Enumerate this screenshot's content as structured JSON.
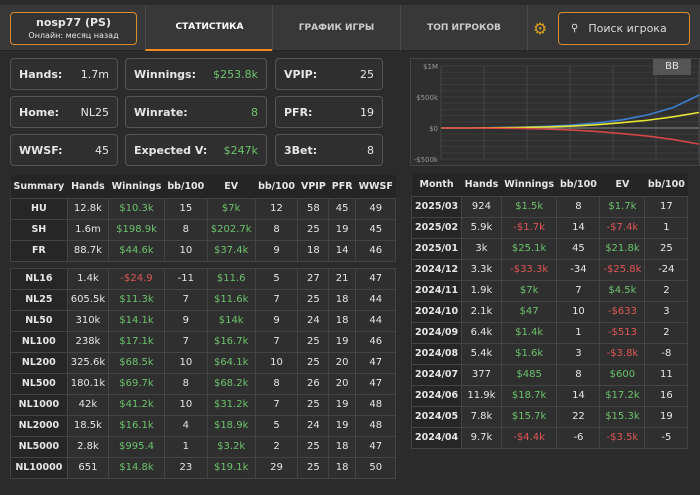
{
  "header": {
    "username": "nosp77 (PS)",
    "status": "Онлайн: месяц назад",
    "tabs": [
      "СТАТИСТИКА",
      "ГРАФИК ИГРЫ",
      "ТОП ИГРОКОВ"
    ],
    "active_tab": 0,
    "search_placeholder": "Поиск игрока"
  },
  "stats": [
    {
      "label": "Hands:",
      "value": "1.7m"
    },
    {
      "label": "Winnings:",
      "value": "$253.8k",
      "color": "green"
    },
    {
      "label": "VPIP:",
      "value": "25"
    },
    {
      "label": "Home:",
      "value": "NL25"
    },
    {
      "label": "Winrate:",
      "value": "8",
      "color": "green"
    },
    {
      "label": "PFR:",
      "value": "19"
    },
    {
      "label": "WWSF:",
      "value": "45"
    },
    {
      "label": "Expected V:",
      "value": "$247k",
      "color": "green"
    },
    {
      "label": "3Bet:",
      "value": "8"
    }
  ],
  "chart_data": {
    "type": "line",
    "unit_toggle": "BB",
    "y_ticks": [
      "$1M",
      "$500k",
      "$0",
      "-$500k"
    ],
    "ylim": [
      -500000,
      1000000
    ],
    "grid": true,
    "series": [
      {
        "color": "#3d7fd6",
        "values": [
          0,
          0,
          5000,
          12000,
          25000,
          45000,
          80000,
          130000,
          210000,
          330000,
          530000
        ]
      },
      {
        "color": "#e6e633",
        "values": [
          0,
          0,
          3000,
          8000,
          16000,
          30000,
          52000,
          85000,
          125000,
          180000,
          250000
        ]
      },
      {
        "color": "#d64545",
        "values": [
          0,
          0,
          -3000,
          -8000,
          -16000,
          -32000,
          -55000,
          -90000,
          -130000,
          -185000,
          -260000
        ]
      }
    ]
  },
  "summary": {
    "headers": [
      "Summary",
      "Hands",
      "Winnings",
      "bb/100",
      "EV",
      "bb/100",
      "VPIP",
      "PFR",
      "WWSF"
    ],
    "rows": [
      [
        "HU",
        "12.8k",
        "$10.3k",
        "15",
        "$7k",
        "12",
        "58",
        "45",
        "49"
      ],
      [
        "SH",
        "1.6m",
        "$198.9k",
        "8",
        "$202.7k",
        "8",
        "25",
        "19",
        "45"
      ],
      [
        "FR",
        "88.7k",
        "$44.6k",
        "10",
        "$37.4k",
        "9",
        "18",
        "14",
        "46"
      ]
    ],
    "limits": [
      [
        "NL16",
        "1.4k",
        "-$24.9",
        "-11",
        "$11.6",
        "5",
        "27",
        "21",
        "47"
      ],
      [
        "NL25",
        "605.5k",
        "$11.3k",
        "7",
        "$11.6k",
        "7",
        "25",
        "18",
        "44"
      ],
      [
        "NL50",
        "310k",
        "$14.1k",
        "9",
        "$14k",
        "9",
        "24",
        "18",
        "44"
      ],
      [
        "NL100",
        "238k",
        "$17.1k",
        "7",
        "$16.7k",
        "7",
        "25",
        "19",
        "46"
      ],
      [
        "NL200",
        "325.6k",
        "$68.5k",
        "10",
        "$64.1k",
        "10",
        "25",
        "20",
        "47"
      ],
      [
        "NL500",
        "180.1k",
        "$69.7k",
        "8",
        "$68.2k",
        "8",
        "26",
        "20",
        "47"
      ],
      [
        "NL1000",
        "42k",
        "$41.2k",
        "10",
        "$31.2k",
        "7",
        "25",
        "19",
        "48"
      ],
      [
        "NL2000",
        "18.5k",
        "$16.1k",
        "4",
        "$18.9k",
        "5",
        "24",
        "19",
        "48"
      ],
      [
        "NL5000",
        "2.8k",
        "$995.4",
        "1",
        "$3.2k",
        "2",
        "25",
        "18",
        "47"
      ],
      [
        "NL10000",
        "651",
        "$14.8k",
        "23",
        "$19.1k",
        "29",
        "25",
        "18",
        "50"
      ]
    ]
  },
  "monthly": {
    "headers": [
      "Month",
      "Hands",
      "Winnings",
      "bb/100",
      "EV",
      "bb/100"
    ],
    "rows": [
      [
        "2025/03",
        "924",
        "$1.5k",
        "8",
        "$1.7k",
        "17"
      ],
      [
        "2025/02",
        "5.9k",
        "-$1.7k",
        "14",
        "-$7.4k",
        "1"
      ],
      [
        "2025/01",
        "3k",
        "$25.1k",
        "45",
        "$21.8k",
        "25"
      ],
      [
        "2024/12",
        "3.3k",
        "-$33.3k",
        "-34",
        "-$25.8k",
        "-24"
      ],
      [
        "2024/11",
        "1.9k",
        "$7k",
        "7",
        "$4.5k",
        "2"
      ],
      [
        "2024/10",
        "2.1k",
        "$47",
        "10",
        "-$633",
        "3"
      ],
      [
        "2024/09",
        "6.4k",
        "$1.4k",
        "1",
        "-$513",
        "2"
      ],
      [
        "2024/08",
        "5.4k",
        "$1.6k",
        "3",
        "-$3.8k",
        "-8"
      ],
      [
        "2024/07",
        "377",
        "$485",
        "8",
        "$600",
        "11"
      ],
      [
        "2024/06",
        "11.9k",
        "$18.7k",
        "14",
        "$17.2k",
        "16"
      ],
      [
        "2024/05",
        "7.8k",
        "$15.7k",
        "22",
        "$15.3k",
        "19"
      ],
      [
        "2024/04",
        "9.7k",
        "-$4.4k",
        "-6",
        "-$3.5k",
        "-5"
      ]
    ]
  }
}
